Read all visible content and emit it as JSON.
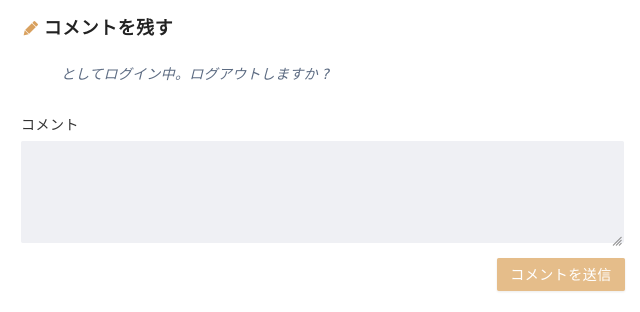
{
  "heading": {
    "icon": "pencil-icon",
    "title": "コメントを残す",
    "icon_color": "#d9a15f"
  },
  "login_note": "としてログイン中。ログアウトしますか ?",
  "comment_field": {
    "label": "コメント",
    "value": "",
    "background": "#eff0f4"
  },
  "submit": {
    "label": "コメントを送信",
    "color": "#e5bd8a"
  }
}
